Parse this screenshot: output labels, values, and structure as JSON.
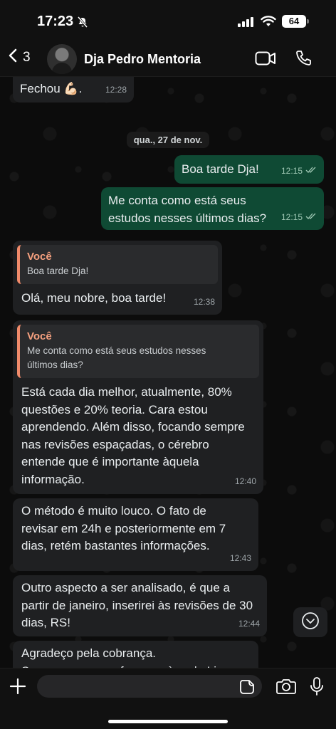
{
  "status_bar": {
    "time": "17:23",
    "battery": "64"
  },
  "header": {
    "back_count": "3",
    "contact_name": "Dja Pedro Mentoria"
  },
  "date_chip": "qua., 27 de nov.",
  "messages": [
    {
      "text": "Fechou 💪🏻.",
      "time": "12:28"
    },
    {
      "text": "Boa tarde Dja!",
      "time": "12:15"
    },
    {
      "text": "Me conta como está seus estudos nesses últimos dias?",
      "time": "12:15"
    },
    {
      "quote_author": "Você",
      "quote_text": "Boa tarde Dja!",
      "text": "Olá, meu nobre, boa tarde!",
      "time": "12:38"
    },
    {
      "quote_author": "Você",
      "quote_text": "Me conta como está seus estudos nesses últimos dias?",
      "text": "Está cada dia melhor, atualmente, 80% questões e 20% teoria. Cara estou aprendendo. Além disso, focando sempre  nas revisões espaçadas, o cérebro entende que é importante àquela informação.",
      "time": "12:40"
    },
    {
      "text": "O método é muito louco. O fato de revisar em 24h e posteriormente em 7 dias, retém bastantes informações.",
      "time": "12:43"
    },
    {
      "text": "Outro aspecto a ser analisado, é que a partir de janeiro, inserirei às revisões de 30 dias, RS!",
      "time": "12:44"
    },
    {
      "text": "Agradeço pela cobrança.\nSempre que vem, faremos àquela Live.",
      "time": ""
    }
  ],
  "input": {
    "placeholder": "",
    "value": ""
  },
  "colors": {
    "outgoing": "#0f4a34",
    "incoming": "#1f2022",
    "quote_accent": "#f08a6a",
    "read_ticks": "#9ec7b3"
  },
  "icons": [
    "bell-slash-icon",
    "signal-icon",
    "wifi-icon",
    "chevron-left-icon",
    "video-icon",
    "phone-icon",
    "double-check-icon",
    "chevron-down-icon",
    "plus-icon",
    "sticker-icon",
    "camera-icon",
    "mic-icon"
  ]
}
